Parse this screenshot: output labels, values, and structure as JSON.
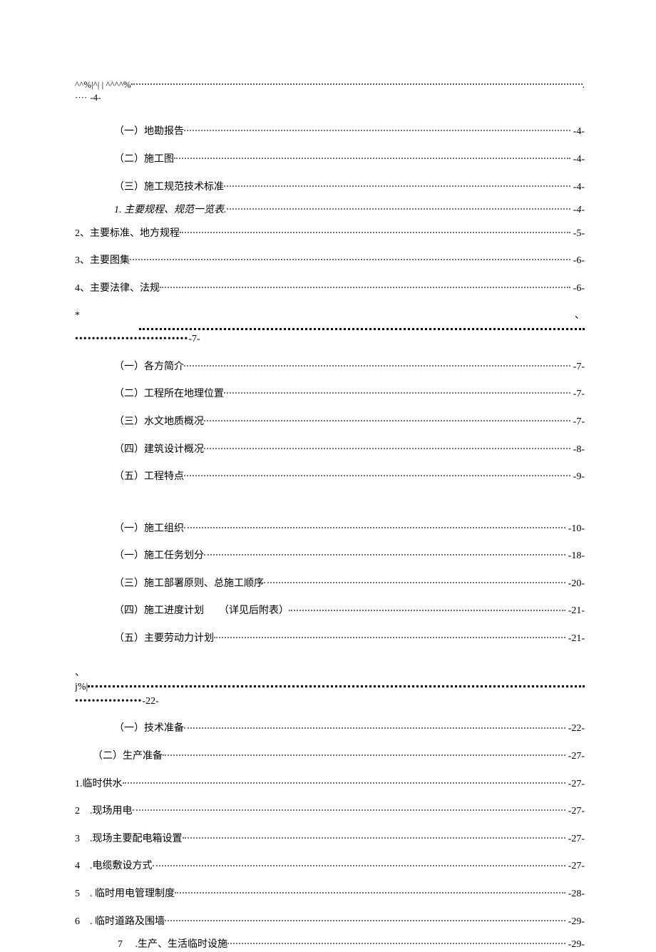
{
  "garbled_header": {
    "pre": "^^%|^| | ^^^^%",
    "tail": "-4-"
  },
  "entries": [
    {
      "kind": "indent-1",
      "label": "（一）地勘报告",
      "page": "-4-"
    },
    {
      "kind": "indent-1",
      "label": "（二）施工图",
      "page": "-4-"
    },
    {
      "kind": "indent-1",
      "label": "（三）施工规范技术标准",
      "page": "-4-"
    },
    {
      "kind": "indent-1 italic",
      "label": "1. 主要规程、规范一览表.",
      "page": "-4-"
    },
    {
      "kind": "indent-0",
      "label": "2、主要标准、地方规程",
      "page": "-5-"
    },
    {
      "kind": "indent-0",
      "label": "3、主要图集",
      "page": "-6-"
    },
    {
      "kind": "indent-0",
      "label": "4、主要法律、法规",
      "page": "-6-"
    }
  ],
  "heavy1": {
    "star": "*",
    "tick": "、",
    "cont_dots": "•••••••••••••••••••••••••••",
    "tail": "-7-"
  },
  "entries2": [
    {
      "kind": "indent-1",
      "label": "（一）各方简介",
      "page": "-7-"
    },
    {
      "kind": "indent-1",
      "label": "（二）工程所在地理位置",
      "page": "-7-"
    },
    {
      "kind": "indent-1",
      "label": "（三）水文地质概况",
      "page": "-7-"
    },
    {
      "kind": "indent-1",
      "label": "（四）建筑设计概况",
      "page": "-8-"
    },
    {
      "kind": "indent-1",
      "label": "（五）工程特点",
      "page": "-9-"
    }
  ],
  "entries3": [
    {
      "kind": "indent-1",
      "label": "（一）施工组织",
      "page": "-10-"
    },
    {
      "kind": "indent-1",
      "label": "（一）施工任务划分",
      "page": "-18-"
    },
    {
      "kind": "indent-1",
      "label": "（三）施工部署原则、总施工顺序",
      "page": "-20-"
    },
    {
      "kind": "indent-1",
      "label": "（四）施工进度计划　　（详见后附表）",
      "page": "-21-"
    },
    {
      "kind": "indent-1",
      "label": "（五）主要劳动力计划",
      "page": "-21-"
    }
  ],
  "heavy2": {
    "tick": "、",
    "pre": "j%|",
    "cont_dots": "••••••••••••••••",
    "tail": "-22-"
  },
  "entries4": [
    {
      "kind": "indent-1",
      "label": "（一）技术准备",
      "page": "-22-"
    },
    {
      "kind": "indent-a",
      "label": "（二）生产准备",
      "page": "-27-"
    },
    {
      "kind": "indent-0",
      "label": "1.临时供水",
      "page": "-27-"
    },
    {
      "kind": "indent-0 spaced",
      "label": "2　.现场用电",
      "page": "-27-"
    },
    {
      "kind": "indent-0 spaced",
      "label": "3　.现场主要配电箱设置",
      "page": "-27-"
    },
    {
      "kind": "indent-0 spaced",
      "label": "4　.电缆敷设方式",
      "page": "-27-"
    },
    {
      "kind": "indent-0 spaced",
      "label": "5　. 临时用电管理制度",
      "page": "-28-"
    },
    {
      "kind": "indent-0 spaced",
      "label": "6　. 临时道路及围墙",
      "page": "-29-"
    },
    {
      "kind": "indent-b spaced",
      "label": "7　 .生产、生活临时设施",
      "page": "-29-"
    }
  ]
}
